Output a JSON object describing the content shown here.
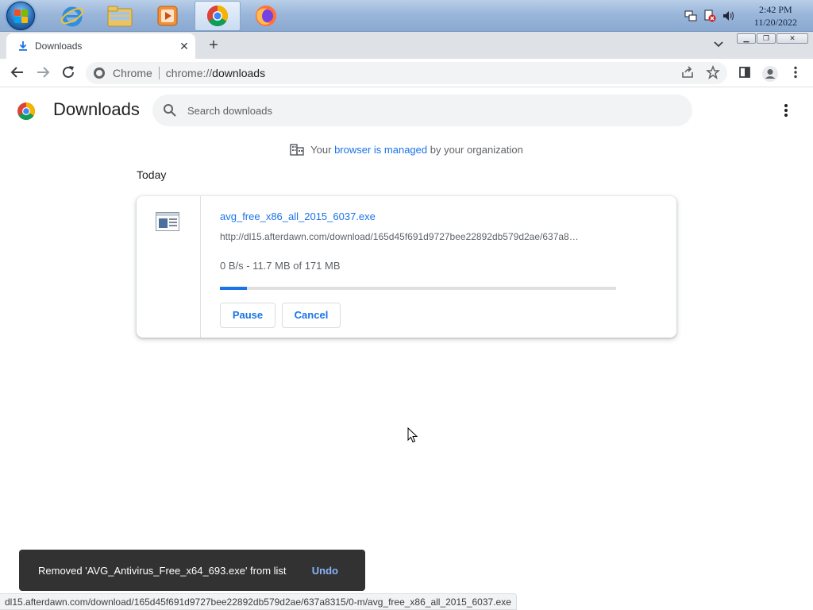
{
  "taskbar": {
    "apps": [
      {
        "name": "Internet Explorer"
      },
      {
        "name": "Windows Explorer"
      },
      {
        "name": "Media Player"
      },
      {
        "name": "Google Chrome",
        "active": true
      },
      {
        "name": "Firefox"
      }
    ],
    "clock": {
      "time": "2:42 PM",
      "date": "11/20/2022"
    }
  },
  "browser": {
    "tab": {
      "title": "Downloads"
    },
    "omnibox": {
      "scheme_label": "Chrome",
      "url_prefix": "chrome://",
      "url_host": "downloads"
    }
  },
  "page": {
    "title": "Downloads",
    "search": {
      "placeholder": "Search downloads"
    },
    "managed": {
      "prefix": "Your ",
      "link": "browser is managed",
      "suffix": " by your organization"
    },
    "date_heading": "Today",
    "download": {
      "file_name": "avg_free_x86_all_2015_6037.exe",
      "url": "http://dl15.afterdawn.com/download/165d45f691d9727bee22892db579d2ae/637a8…",
      "progress_text": "0 B/s - 11.7 MB of 171 MB",
      "progress_fraction": 0.068,
      "pause_label": "Pause",
      "cancel_label": "Cancel"
    }
  },
  "toast": {
    "message": "Removed 'AVG_Antivirus_Free_x64_693.exe' from list",
    "undo_label": "Undo"
  },
  "status_bar": {
    "url": "dl15.afterdawn.com/download/165d45f691d9727bee22892db579d2ae/637a8315/0-m/avg_free_x86_all_2015_6037.exe"
  },
  "colors": {
    "accent": "#1a73e8",
    "toast_bg": "#323232",
    "undo": "#8ab4f8"
  }
}
